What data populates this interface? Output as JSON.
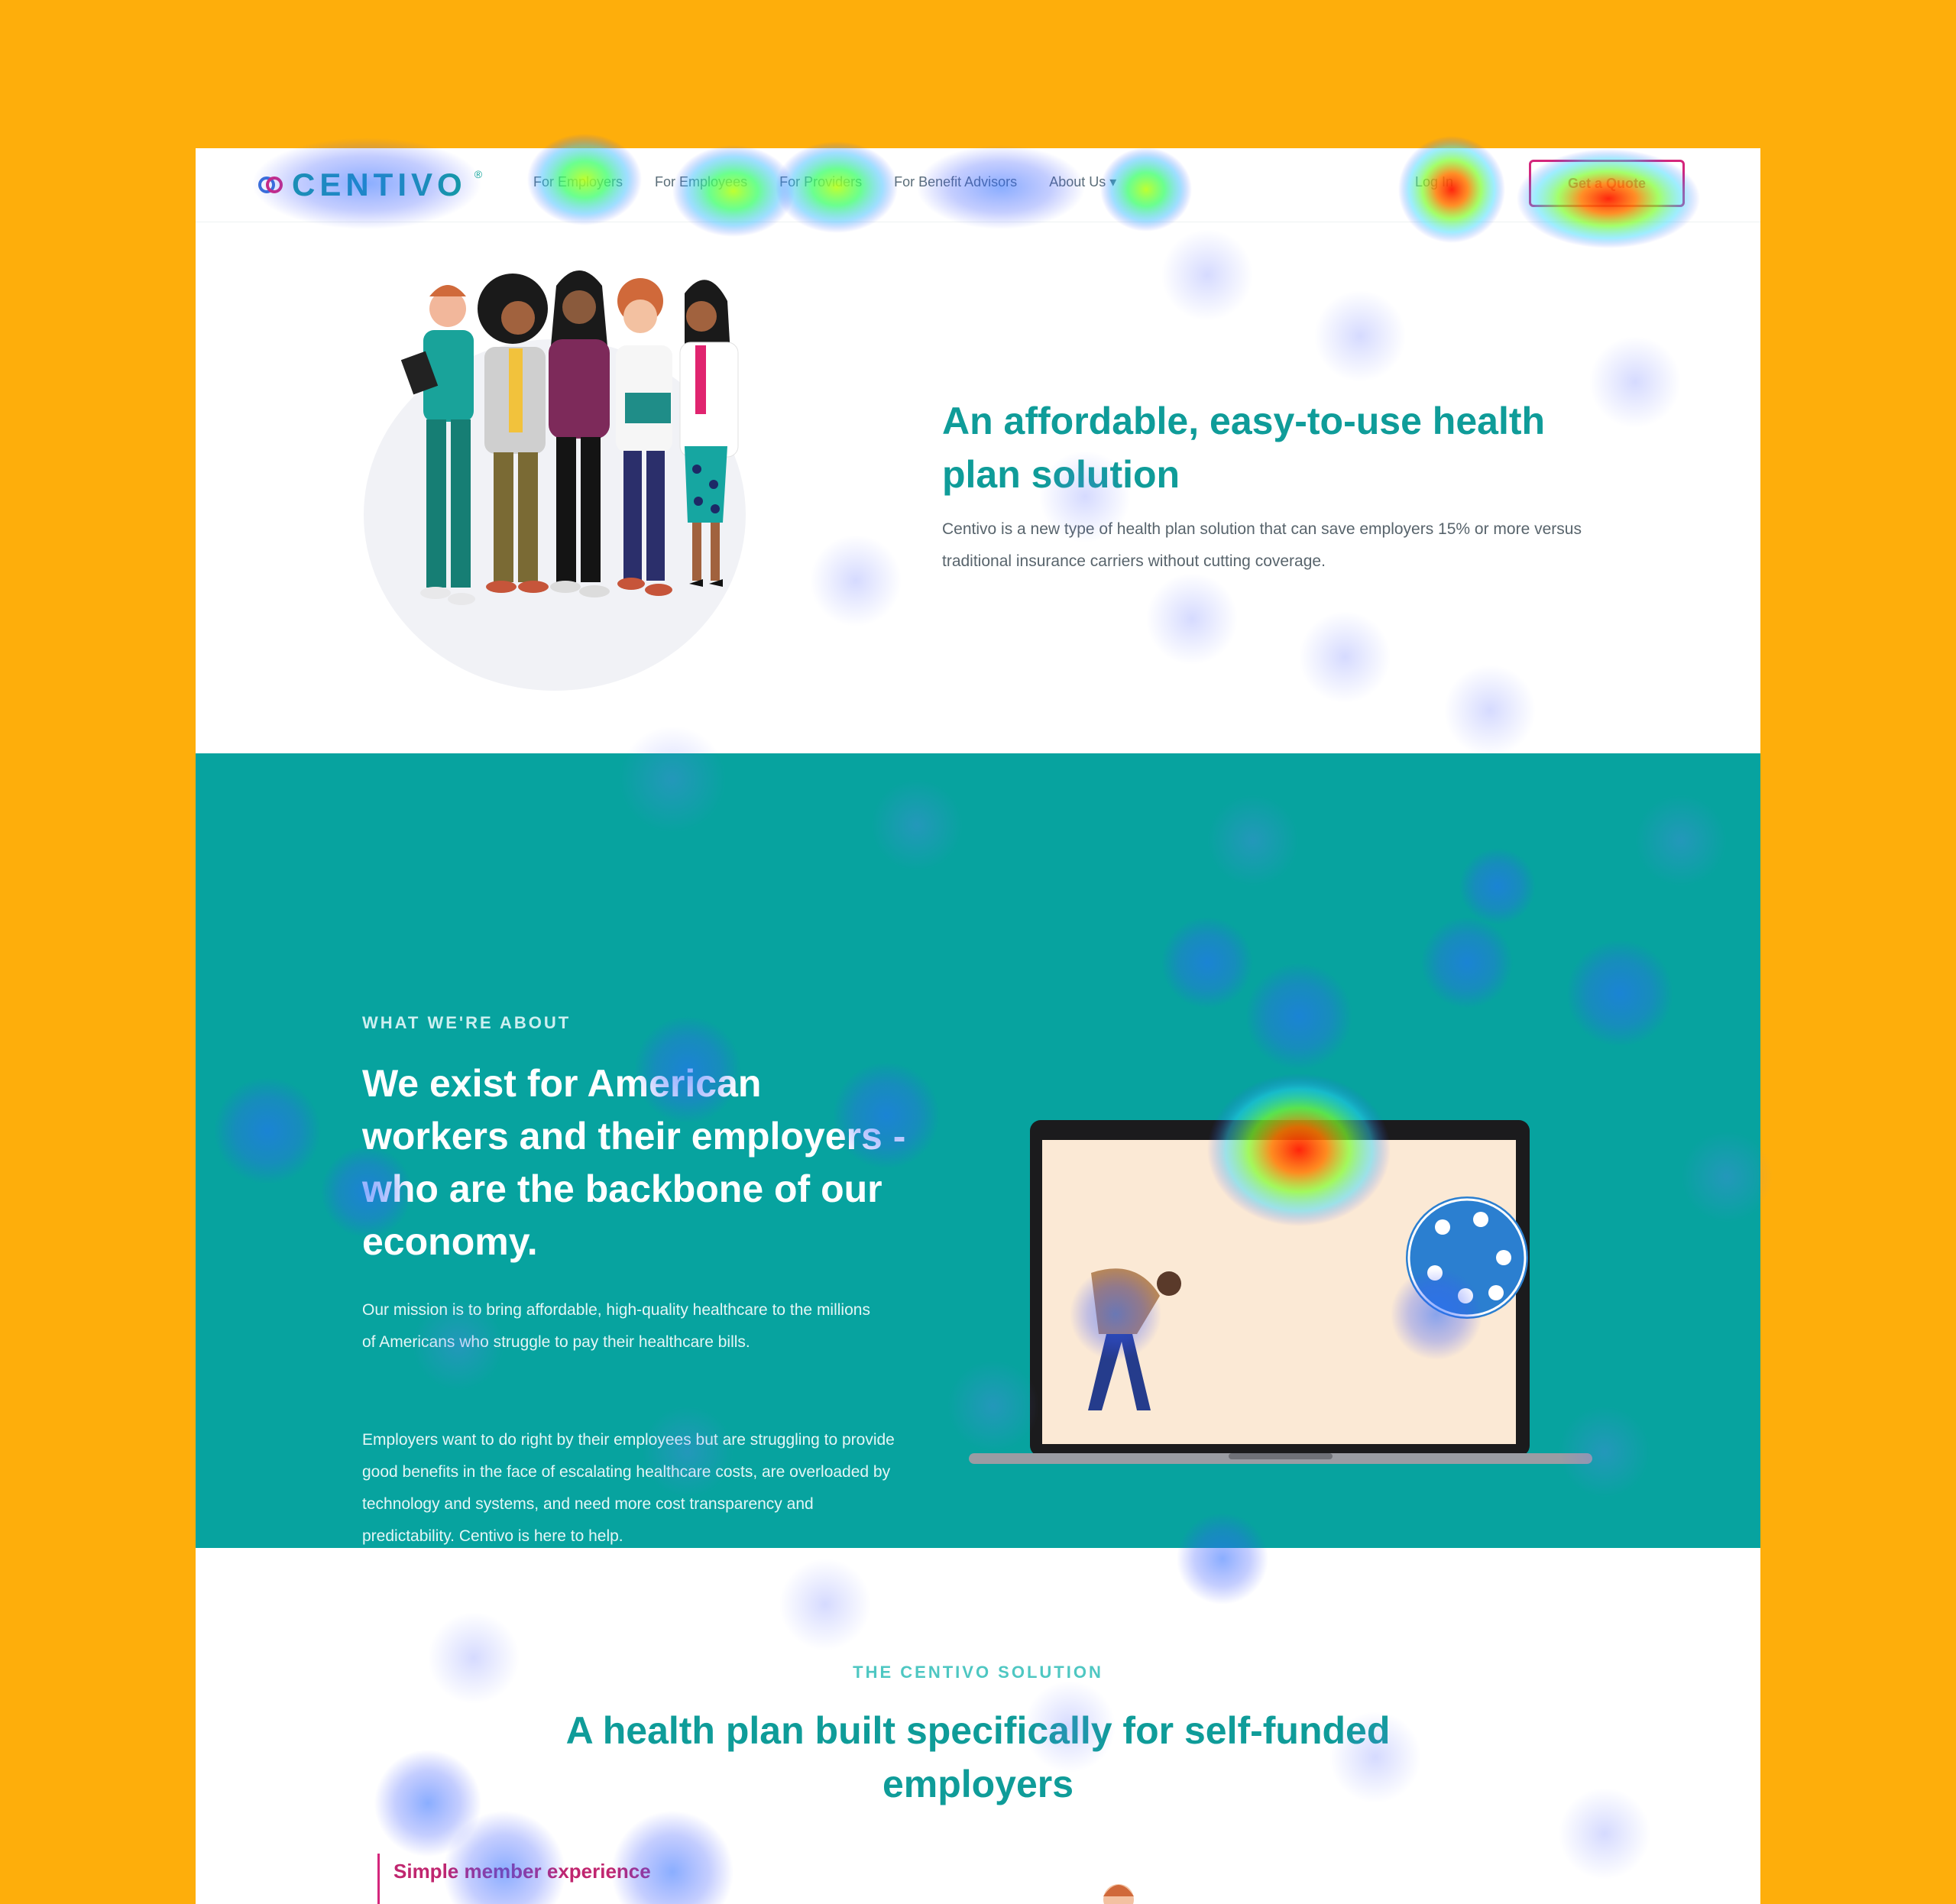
{
  "nav": {
    "logo_text": "CENTIVO",
    "logo_reg": "®",
    "links": [
      "For Employers",
      "For Employees",
      "For Providers",
      "For Benefit Advisors",
      "About Us ▾"
    ],
    "login": "Log In",
    "cta": "Get a Quote"
  },
  "hero": {
    "title": "An affordable, easy-to-use health plan solution",
    "text": "Centivo is a new type of health plan solution that can save employers 15% or more versus traditional insurance carriers without cutting coverage."
  },
  "about": {
    "eyebrow": "WHAT WE'RE ABOUT",
    "title": "We exist for American workers and their employers - who are the backbone of our economy.",
    "p1": "Our mission is to bring affordable, high-quality healthcare to the millions of Americans who struggle to pay their healthcare bills.",
    "p2": "Employers want to do right by their employees but are struggling to provide good benefits in the face of escalating healthcare costs, are overloaded by technology and systems, and need more cost transparency and predictability. Centivo is here to help."
  },
  "solution": {
    "eyebrow": "THE CENTIVO SOLUTION",
    "title": "A health plan built specifically for self-funded employers",
    "feature_1": "Simple member experience"
  },
  "colors": {
    "background": "#FEAE0B",
    "teal": "#07A39F",
    "heading": "#0F9C99",
    "accent": "#D4267C"
  }
}
